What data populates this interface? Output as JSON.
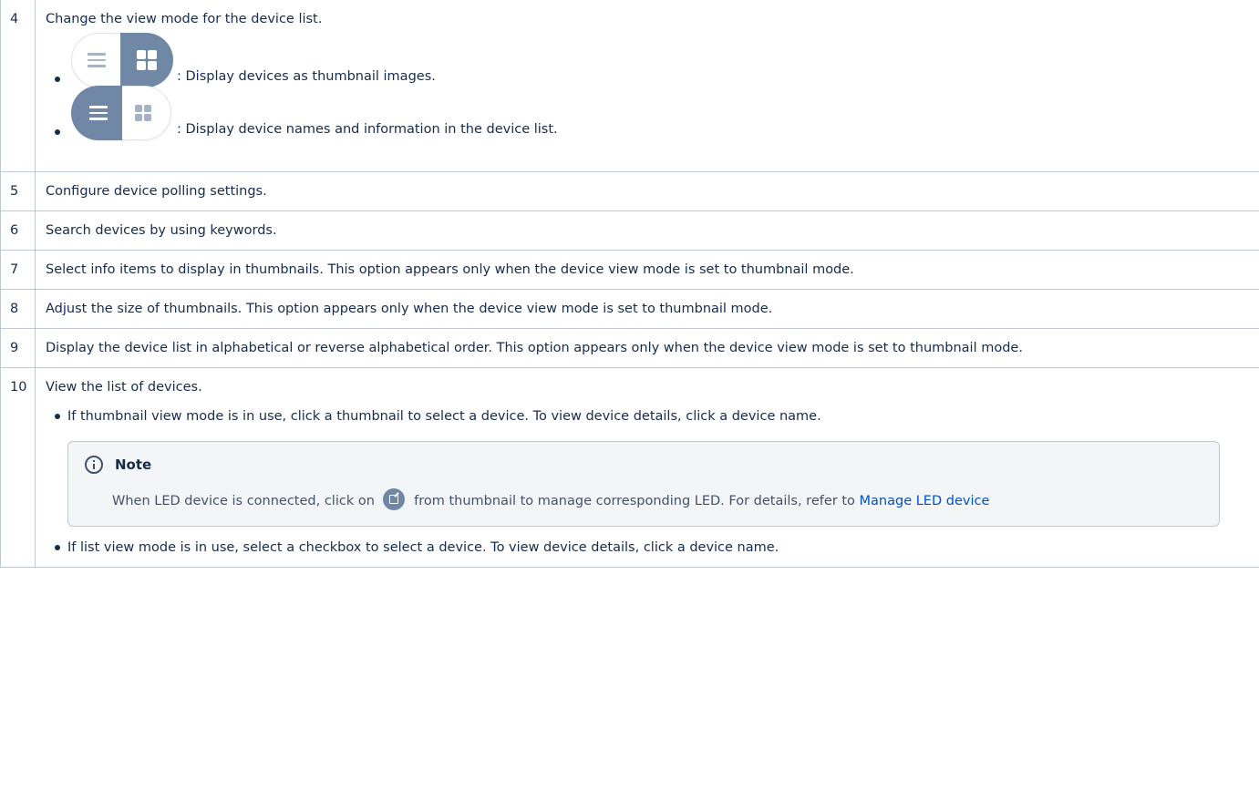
{
  "rows": [
    {
      "num": "4",
      "text": "Change the view mode for the device list.",
      "items": [
        {
          "icon": "thumbnail-view-toggle-icon",
          "text": ": Display devices as thumbnail images."
        },
        {
          "icon": "list-view-toggle-icon",
          "text": ": Display device names and information in the device list."
        }
      ]
    },
    {
      "num": "5",
      "text": "Configure device polling settings."
    },
    {
      "num": "6",
      "text": "Search devices by using keywords."
    },
    {
      "num": "7",
      "text": "Select info items to display in thumbnails. This option appears only when the device view mode is set to thumbnail mode."
    },
    {
      "num": "8",
      "text": "Adjust the size of thumbnails. This option appears only when the device view mode is set to thumbnail mode."
    },
    {
      "num": "9",
      "text": "Display the device list in alphabetical or reverse alphabetical order. This option appears only when the device view mode is set to thumbnail mode."
    },
    {
      "num": "10",
      "text": "View the list of devices.",
      "items": [
        {
          "text": "If thumbnail view mode is in use, click a thumbnail to select a device. To view device details, click a device name."
        },
        {
          "text": "If list view mode is in use, select a checkbox to select a device. To view device details, click a device name."
        }
      ],
      "note": {
        "title": "Note",
        "text_before": "When LED device is connected, click on",
        "icon": "external-link-icon",
        "text_after": "from thumbnail to manage corresponding LED. For details, refer to",
        "link_text": "Manage LED device"
      }
    }
  ],
  "colors": {
    "text": "#172b4d",
    "border": "#c1c7d0",
    "toggle_active": "#7088a6",
    "toggle_inactive_icon": "#a5b3c5",
    "note_bg": "#f4f5f7",
    "link": "#0052cc"
  }
}
